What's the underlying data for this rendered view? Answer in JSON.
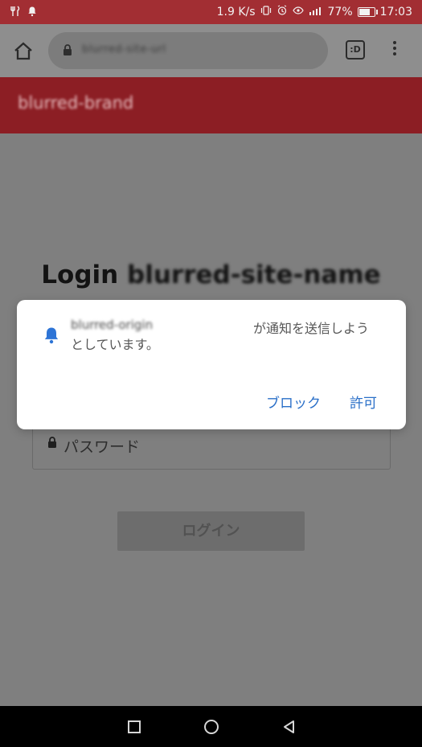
{
  "status_bar": {
    "speed": "1.9 K/s",
    "battery": "77%",
    "time": "17:03",
    "icons": [
      "fork-knife-icon",
      "bell-icon",
      "vibrate-icon",
      "alarm-icon",
      "eye-icon",
      "signal-icon",
      "battery-icon"
    ]
  },
  "browser": {
    "url_placeholder": "blurred-site-url",
    "tab_label": ":D",
    "icons": [
      "home-icon",
      "lock-icon",
      "tabs-icon",
      "menu-dots-icon"
    ]
  },
  "site": {
    "brand": "blurred-brand"
  },
  "login": {
    "title_prefix": "Login",
    "title_suffix": "blurred-site-name",
    "password_placeholder": "パスワード",
    "button_label": "ログイン"
  },
  "prompt": {
    "origin": "blurred-origin",
    "message_line1": "が通知を送信しよう",
    "message_line2": "としています。",
    "block_label": "ブロック",
    "allow_label": "許可",
    "icons": [
      "notification-bell-icon"
    ]
  },
  "navigation": {
    "icons": [
      "recent-apps-icon",
      "home-circle-icon",
      "back-triangle-icon"
    ]
  },
  "colors": {
    "status_bar": "#a22e33",
    "toolbar": "#8e8e8e",
    "site_header": "#8c1e24",
    "page_overlay": "#7f7f7f",
    "accent_blue": "#2a6fc8"
  }
}
